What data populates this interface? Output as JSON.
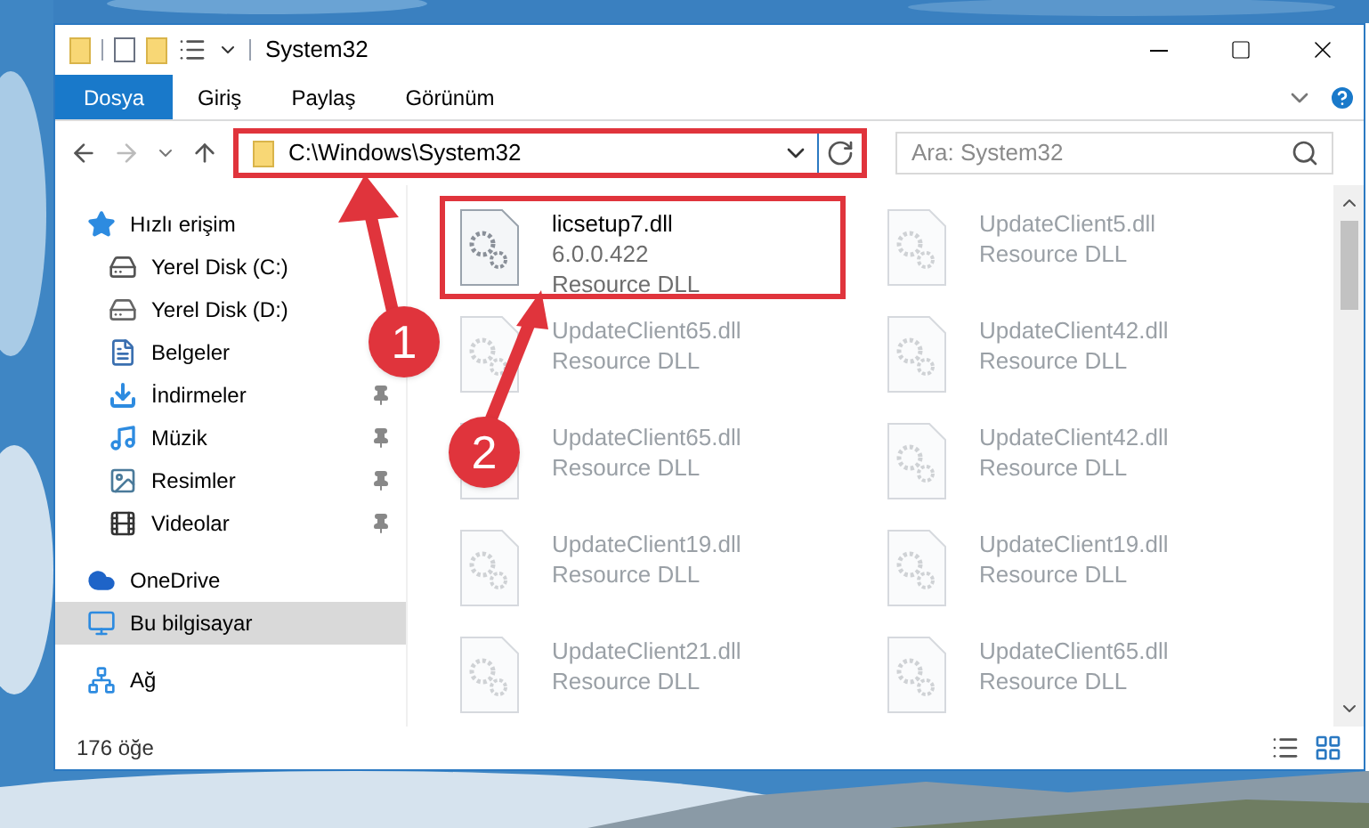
{
  "window": {
    "title": "System32"
  },
  "ribbon": {
    "tabs": [
      {
        "label": "Dosya",
        "kind": "file"
      },
      {
        "label": "Giriş",
        "kind": "tab"
      },
      {
        "label": "Paylaş",
        "kind": "tab"
      },
      {
        "label": "Görünüm",
        "kind": "tab"
      }
    ]
  },
  "address_bar": {
    "path": "C:\\Windows\\System32",
    "highlighted": true
  },
  "search": {
    "placeholder": "Ara: System32"
  },
  "sidebar": {
    "items": [
      {
        "label": "Hızlı erişim",
        "kind": "quick",
        "pinned": false,
        "selected": false
      },
      {
        "label": "Yerel Disk (C:)",
        "kind": "system-drive",
        "pinned": false,
        "selected": false
      },
      {
        "label": "Yerel Disk (D:)",
        "kind": "drive",
        "pinned": false,
        "selected": false
      },
      {
        "label": "Belgeler",
        "kind": "documents",
        "pinned": false,
        "selected": false
      },
      {
        "label": "İndirmeler",
        "kind": "downloads",
        "pinned": true,
        "selected": false
      },
      {
        "label": "Müzik",
        "kind": "music",
        "pinned": true,
        "selected": false
      },
      {
        "label": "Resimler",
        "kind": "pictures",
        "pinned": true,
        "selected": false
      },
      {
        "label": "Videolar",
        "kind": "videos",
        "pinned": true,
        "selected": false
      },
      {
        "label": "OneDrive",
        "kind": "cloud",
        "pinned": false,
        "selected": false
      },
      {
        "label": "Bu bilgisayar",
        "kind": "pc",
        "pinned": false,
        "selected": true
      },
      {
        "label": "Ağ",
        "kind": "network",
        "pinned": false,
        "selected": false
      }
    ]
  },
  "files": [
    {
      "name": "licsetup7.dll",
      "version": "6.0.0.422",
      "type": "Resource DLL",
      "faded": false,
      "highlighted": true
    },
    {
      "name": "UpdateClient5.dll",
      "type": "Resource DLL",
      "faded": true,
      "highlighted": false
    },
    {
      "name": "UpdateClient65.dll",
      "type": "Resource DLL",
      "faded": true,
      "highlighted": false
    },
    {
      "name": "UpdateClient42.dll",
      "type": "Resource DLL",
      "faded": true,
      "highlighted": false
    },
    {
      "name": "UpdateClient65.dll",
      "type": "Resource DLL",
      "faded": true,
      "highlighted": false
    },
    {
      "name": "UpdateClient42.dll",
      "type": "Resource DLL",
      "faded": true,
      "highlighted": false
    },
    {
      "name": "UpdateClient19.dll",
      "type": "Resource DLL",
      "faded": true,
      "highlighted": false
    },
    {
      "name": "UpdateClient19.dll",
      "type": "Resource DLL",
      "faded": true,
      "highlighted": false
    },
    {
      "name": "UpdateClient21.dll",
      "type": "Resource DLL",
      "faded": true,
      "highlighted": false
    },
    {
      "name": "UpdateClient65.dll",
      "type": "Resource DLL",
      "faded": true,
      "highlighted": false
    }
  ],
  "status_bar": {
    "count": "176 öğe"
  },
  "annotations": [
    {
      "label": "1"
    },
    {
      "label": "2"
    }
  ]
}
